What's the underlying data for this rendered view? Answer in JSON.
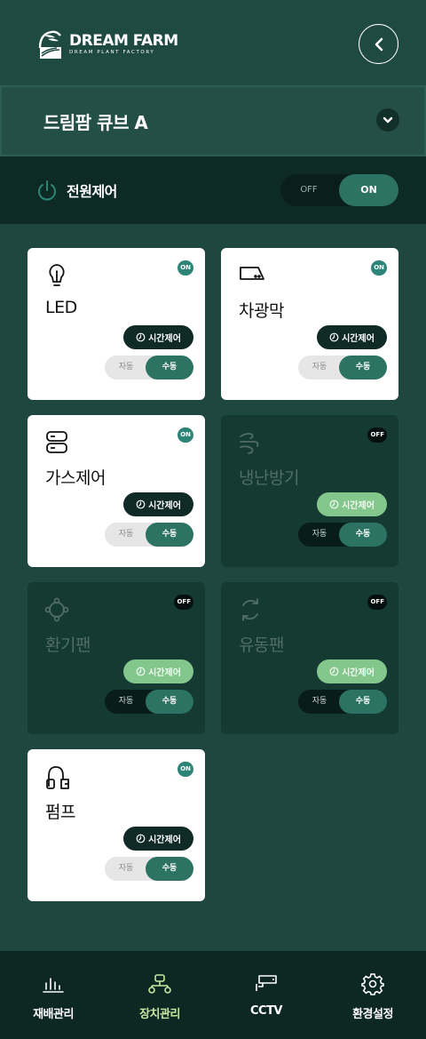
{
  "header": {
    "logo_main": "DREAM FARM",
    "logo_sub": "DREAM PLANT FACTORY",
    "back_icon": "chevron-left-icon"
  },
  "selector": {
    "title": "드림팜 큐브 A",
    "dropdown_icon": "chevron-down-icon"
  },
  "power": {
    "label": "전원제어",
    "off_label": "OFF",
    "on_label": "ON",
    "state": "ON"
  },
  "devices": [
    {
      "name": "LED",
      "status": "ON",
      "icon": "lightbulb-icon",
      "timer_label": "시간제어",
      "auto_label": "자동",
      "manual_label": "수동",
      "mode": "수동"
    },
    {
      "name": "차광막",
      "status": "ON",
      "icon": "shade-icon",
      "timer_label": "시간제어",
      "auto_label": "자동",
      "manual_label": "수동",
      "mode": "수동"
    },
    {
      "name": "가스제어",
      "status": "ON",
      "icon": "gas-tank-icon",
      "timer_label": "시간제어",
      "auto_label": "자동",
      "manual_label": "수동",
      "mode": "수동"
    },
    {
      "name": "냉난방기",
      "status": "OFF",
      "icon": "wind-icon",
      "timer_label": "시간제어",
      "auto_label": "자동",
      "manual_label": "수동",
      "mode": "수동"
    },
    {
      "name": "환기팬",
      "status": "OFF",
      "icon": "ventilation-fan-icon",
      "timer_label": "시간제어",
      "auto_label": "자동",
      "manual_label": "수동",
      "mode": "수동"
    },
    {
      "name": "유동팬",
      "status": "OFF",
      "icon": "circulation-icon",
      "timer_label": "시간제어",
      "auto_label": "자동",
      "manual_label": "수동",
      "mode": "수동"
    },
    {
      "name": "펌프",
      "status": "ON",
      "icon": "pump-icon",
      "timer_label": "시간제어",
      "auto_label": "자동",
      "manual_label": "수동",
      "mode": "수동"
    }
  ],
  "nav": [
    {
      "label": "재배관리",
      "icon": "bar-chart-icon",
      "active": false
    },
    {
      "label": "장치관리",
      "icon": "device-network-icon",
      "active": true
    },
    {
      "label": "CCTV",
      "icon": "cctv-camera-icon",
      "active": false
    },
    {
      "label": "환경설정",
      "icon": "gear-icon",
      "active": false
    }
  ],
  "colors": {
    "background": "#1e473f",
    "accent": "#2d7363",
    "active_nav": "#c7e8a4",
    "timer_off": "#84c78c"
  }
}
